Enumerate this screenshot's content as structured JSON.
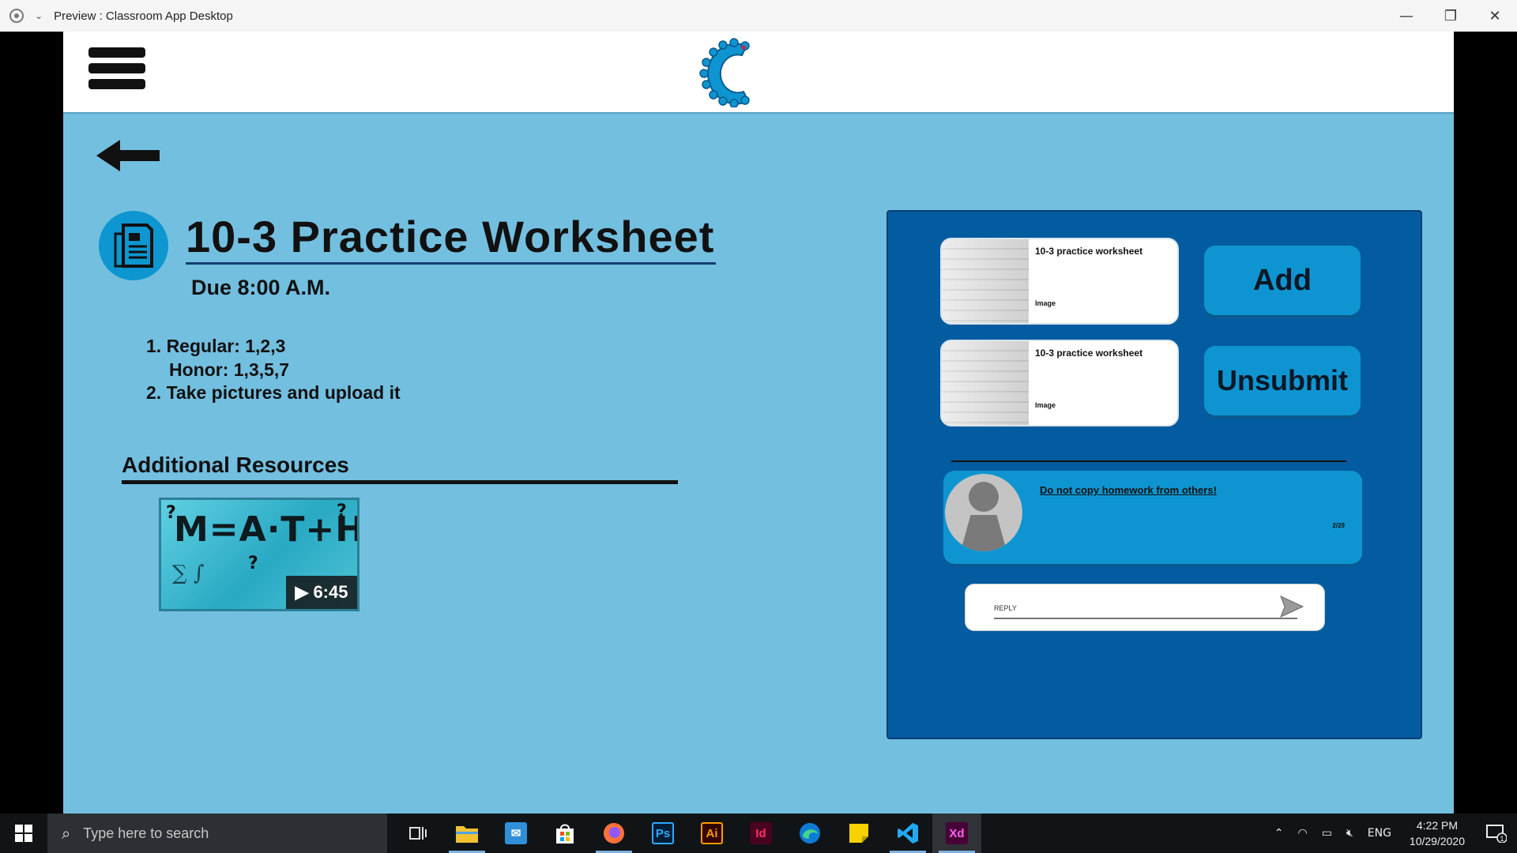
{
  "window": {
    "title": "Preview : Classroom App Desktop",
    "minimize_glyph": "—",
    "restore_glyph": "❐",
    "close_glyph": "✕"
  },
  "assignment": {
    "title": "10-3 Practice Worksheet",
    "due": "Due 8:00 A.M.",
    "instructions": [
      "1. Regular: 1,2,3",
      "Honor: 1,3,5,7",
      "2. Take pictures and upload it"
    ]
  },
  "resources": {
    "heading": "Additional Resources",
    "video": {
      "title": "M=A·T+H",
      "duration": "6:45"
    }
  },
  "submission": {
    "files": [
      {
        "name": "10-3 practice worksheet",
        "type": "Image"
      },
      {
        "name": "10-3 practice worksheet",
        "type": "Image"
      }
    ],
    "add_label": "Add",
    "unsubmit_label": "Unsubmit"
  },
  "comment": {
    "text": "Do not copy homework from others!",
    "date": "2/29"
  },
  "reply": {
    "placeholder": "REPLY"
  },
  "taskbar": {
    "search_placeholder": "Type here to search",
    "apps": [
      "task-view",
      "file-explorer",
      "outlook",
      "microsoft-store",
      "firefox",
      "photoshop",
      "illustrator",
      "indesign",
      "edge",
      "sticky-notes",
      "vscode",
      "xd"
    ],
    "ps_label": "Ps",
    "ai_label": "Ai",
    "id_label": "Id",
    "xd_label": "Xd",
    "language": "ENG",
    "time": "4:22 PM",
    "date": "10/29/2020",
    "notification_count": "1"
  },
  "colors": {
    "background": "#73bfe0",
    "panel": "#035ba0",
    "button": "#0e95d1"
  }
}
